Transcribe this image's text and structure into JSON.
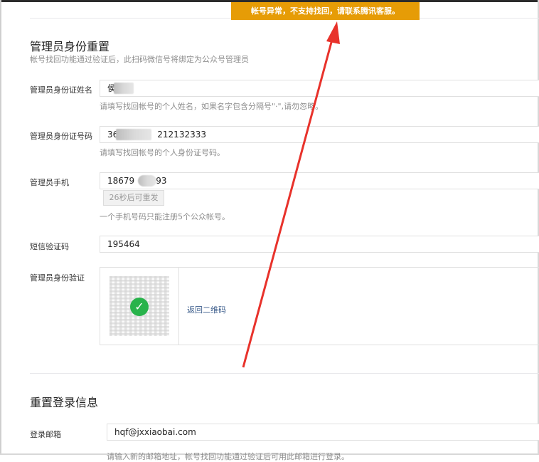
{
  "banner": {
    "text": "帐号异常，不支持找回，请联系腾讯客服。",
    "color": "#e69c06"
  },
  "identity_reset": {
    "title": "管理员身份重置",
    "subtitle": "帐号找回功能通过验证后，此扫码微信号将绑定为公众号管理员",
    "name": {
      "label": "管理员身份证姓名",
      "value": "侯",
      "hint": "请填写找回帐号的个人姓名，如果名字包含分隔号\"·\",请勿忽略。"
    },
    "id_number": {
      "label": "管理员身份证号码",
      "prefix": "36",
      "suffix": "212132333",
      "hint": "请填写找回帐号的个人身份证号码。"
    },
    "phone": {
      "label": "管理员手机",
      "prefix": "18679",
      "suffix": "93",
      "resend_label": "26秒后可重发",
      "hint": "一个手机号码只能注册5个公众帐号。"
    },
    "sms": {
      "label": "短信验证码",
      "value": "195464"
    },
    "verify": {
      "label": "管理员身份验证",
      "check_icon": "check-icon",
      "back_link": "返回二维码",
      "check_color": "#28b34b"
    }
  },
  "login_reset": {
    "title": "重置登录信息",
    "email": {
      "label": "登录邮箱",
      "value": "hqf@jxxiaobai.com",
      "hint": "请输入新的邮箱地址，帐号找回功能通过验证后可用此邮箱进行登录。"
    }
  },
  "annotation": {
    "arrow_color": "#e8322b"
  }
}
